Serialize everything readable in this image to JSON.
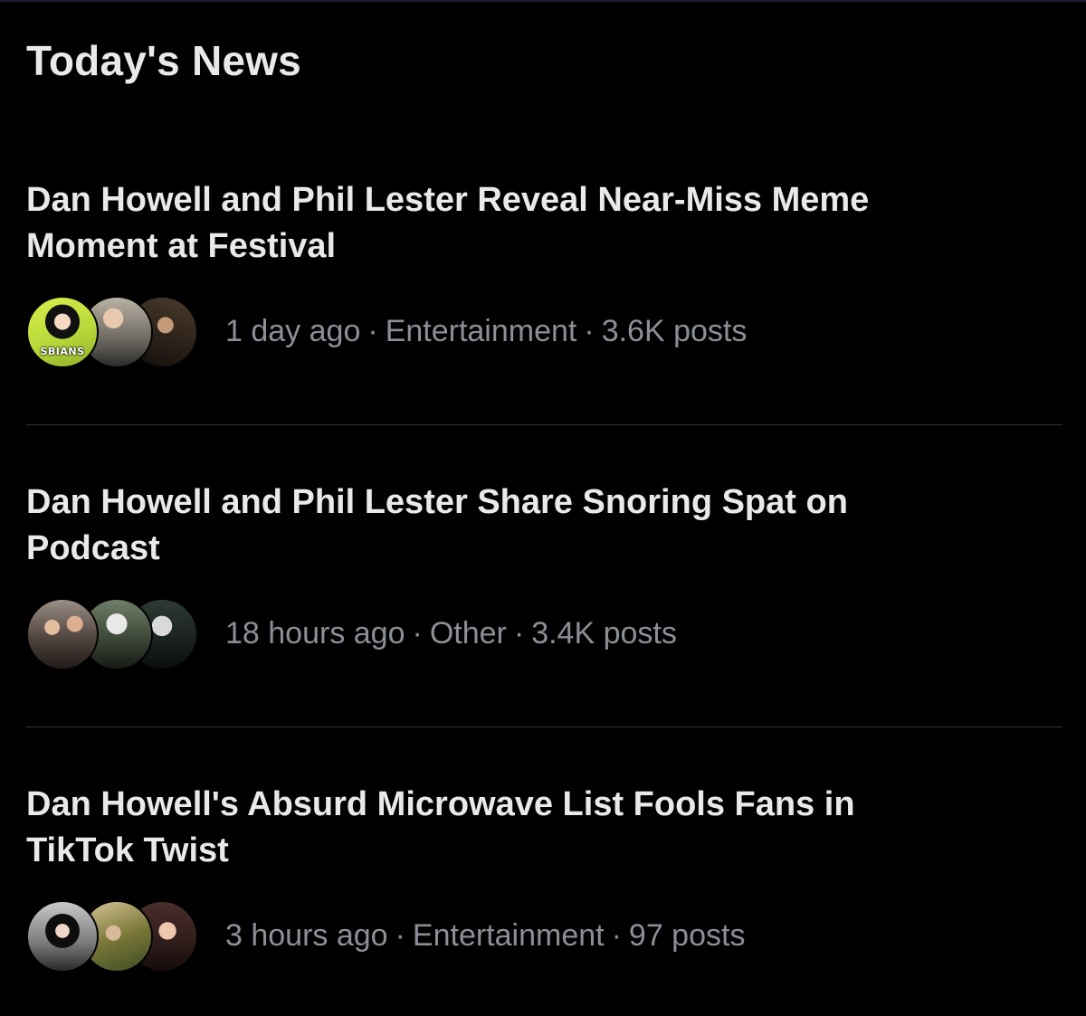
{
  "section": {
    "title": "Today's News"
  },
  "stories": [
    {
      "headline": "Dan Howell and Phil Lester Reveal Near-Miss Meme Moment at Festival",
      "time": "1 day ago",
      "category": "Entertainment",
      "posts": "3.6K posts",
      "avatar_caption": "SBIANS"
    },
    {
      "headline": "Dan Howell and Phil Lester Share Snoring Spat on Podcast",
      "time": "18 hours ago",
      "category": "Other",
      "posts": "3.4K posts"
    },
    {
      "headline": "Dan Howell's Absurd Microwave List Fools Fans in TikTok Twist",
      "time": "3 hours ago",
      "category": "Entertainment",
      "posts": "97 posts"
    }
  ],
  "separator": "·",
  "colors": {
    "background": "#000000",
    "headline": "#e7e9ea",
    "meta": "#8b8f96",
    "divider": "#2f3336"
  }
}
